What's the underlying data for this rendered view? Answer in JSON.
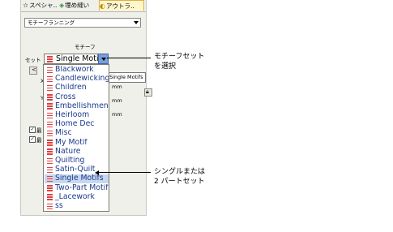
{
  "tabs": [
    {
      "label": "スペシャ..",
      "icon": "star-icon"
    },
    {
      "label": "埋め縫い",
      "icon": "fill-icon"
    },
    {
      "label": "アウトラ..",
      "icon": "outline-icon"
    }
  ],
  "mode_select": {
    "value": "モチーフランニング"
  },
  "motif_heading": "モチーフ",
  "set_label": "セット",
  "set_select": {
    "value": "Single Motifs"
  },
  "tooltip": "Single Motifs",
  "partial_labels": {
    "x": "X",
    "y": "Y",
    "mm1": "mm",
    "mm2": "mm",
    "mm3": "mm",
    "check1": "最",
    "check2": "最"
  },
  "motif_sets": [
    "Blackwork",
    "Candlewicking",
    "Children",
    "Cross",
    "Embellishment",
    "Heirloom",
    "Home Dec",
    "Misc",
    "My Motif",
    "Nature",
    "Quilting",
    "Satin-Quilt",
    "Single Motifs",
    "Two-Part Motifs",
    "_Lacework",
    "ss"
  ],
  "selected_set": "Single Motifs",
  "callouts": {
    "top": [
      "モチーフセット",
      "を選択"
    ],
    "bottom": [
      "シングルまたは",
      "2 パートセット"
    ]
  },
  "colors": {
    "motif_icon": "#e04040",
    "selected_row": "#c7d7ef",
    "list_text": "#1b3a8c"
  }
}
